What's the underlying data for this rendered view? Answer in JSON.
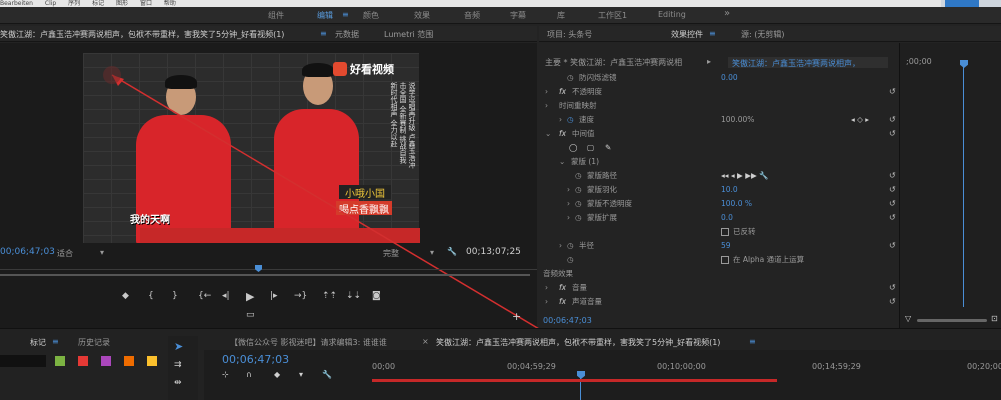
{
  "menubar": {
    "items": [
      "Bearbeiten",
      "Clip",
      "序列",
      "标记",
      "图形",
      "窗口",
      "帮助"
    ]
  },
  "workspace": {
    "tabs": [
      "组件",
      "编辑",
      "颜色",
      "效果",
      "音频",
      "字幕",
      "库",
      "工作区1",
      "Editing"
    ],
    "active_index": 1,
    "more": "»"
  },
  "program": {
    "tabs": [
      "笑傲江湖：卢鑫玉浩冲赛两说相声，包袱不带重样，害我笑了5分钟_好看视频(1)",
      "元数据",
      "Lumetri 范围"
    ],
    "video": {
      "logo": "好看视频",
      "caption_left": "我的天啊",
      "sub1": "小哦小国",
      "sub2": "喝点香飘飘",
      "side_text": "说学逗唱再升级 卢鑫玉浩冲击全国 全新赛制 挑战自我 新时代相声 全力以赴"
    },
    "timecode_current": "00;06;47;03",
    "fit": "适合",
    "quality": "完整",
    "timecode_total": "00;13;07;25",
    "transport_icons": [
      "marker-icon",
      "in-point-icon",
      "out-point-icon",
      "goto-in-icon",
      "step-back-icon",
      "play-icon",
      "step-forward-icon",
      "goto-out-icon",
      "lift-icon",
      "extract-icon",
      "camera-icon"
    ]
  },
  "effects": {
    "tabs": [
      "项目: 头条号",
      "效果控件",
      "源: (无剪辑)"
    ],
    "active_tab": 1,
    "master": "主要 * 笑傲江湖：卢鑫玉浩冲赛两说相",
    "clip": "笑傲江湖：卢鑫玉浩冲赛两说相声，",
    "timeline_start": ";00;00",
    "rows": [
      {
        "label": "防闪烁滤镜",
        "value": "0.00",
        "indent": 2
      },
      {
        "label": "不透明度",
        "value": "",
        "indent": 1,
        "fx": true
      },
      {
        "label": "时间重映射",
        "value": "",
        "indent": 1
      },
      {
        "label": "速度",
        "value": "100.00%",
        "indent": 2
      },
      {
        "label": "中间值",
        "value": "",
        "indent": 1,
        "fx": true
      },
      {
        "label": "",
        "value": "",
        "indent": 2
      },
      {
        "label": "蒙版 (1)",
        "value": "",
        "indent": 2
      },
      {
        "label": "蒙版路径",
        "value": "",
        "indent": 3
      },
      {
        "label": "蒙版羽化",
        "value": "10.0",
        "indent": 3
      },
      {
        "label": "蒙版不透明度",
        "value": "100.0 %",
        "indent": 3
      },
      {
        "label": "蒙版扩展",
        "value": "0.0",
        "indent": 3
      },
      {
        "label": "",
        "value": "已反转",
        "indent": 3
      },
      {
        "label": "半径",
        "value": "59",
        "indent": 2
      },
      {
        "label": "",
        "value": "在 Alpha 通道上运算",
        "indent": 2
      },
      {
        "label": "音频效果",
        "value": "",
        "indent": 0
      },
      {
        "label": "音量",
        "value": "",
        "indent": 1,
        "fx": true
      },
      {
        "label": "声道音量",
        "value": "",
        "indent": 1,
        "fx": true
      }
    ],
    "footer_time": "00;06;47;03"
  },
  "markers": {
    "tabs": [
      "标记",
      "历史记录"
    ],
    "colors": [
      "#7cb342",
      "#e53935",
      "#ab47bc",
      "#ef6c00",
      "#fbc02d"
    ]
  },
  "sequence": {
    "tabs": [
      "【微信公众号 影视迷吧】请求编辑3: 谁谁谁",
      "笑傲江湖：卢鑫玉浩冲赛两说相声，包袱不带重样，害我笑了5分钟_好看视频(1)"
    ],
    "timecode": "00;06;47;03",
    "ruler": [
      "00;00",
      "00;04;59;29",
      "00;10;00;00",
      "00;14;59;29",
      "00;20;00"
    ]
  }
}
